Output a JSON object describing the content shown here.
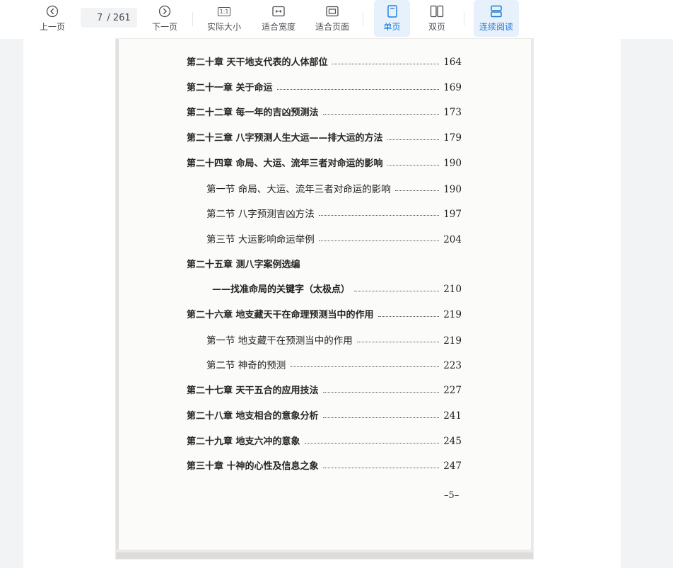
{
  "toolbar": {
    "prev_label": "上一页",
    "next_label": "下一页",
    "current_page": "7",
    "total_pages": "261",
    "actual_size_label": "实际大小",
    "actual_size_glyph": "1:1",
    "fit_width_label": "适合宽度",
    "fit_page_label": "适合页面",
    "single_page_label": "单页",
    "double_page_label": "双页",
    "continuous_label": "连续阅读",
    "accent_color": "#1e7ad6"
  },
  "document": {
    "toc": [
      {
        "type": "chapter",
        "title": "第二十章  天干地支代表的人体部位",
        "page": "164"
      },
      {
        "type": "chapter",
        "title": "第二十一章  关于命运",
        "page": "169"
      },
      {
        "type": "chapter",
        "title": "第二十二章  每一年的吉凶预测法",
        "page": "173"
      },
      {
        "type": "chapter",
        "title": "第二十三章  八字预测人生大运——排大运的方法",
        "page": "179"
      },
      {
        "type": "chapter",
        "title": "第二十四章  命局、大运、流年三者对命运的影响",
        "page": "190"
      },
      {
        "type": "section",
        "title": "第一节  命局、大运、流年三者对命运的影响",
        "page": "190"
      },
      {
        "type": "section",
        "title": "第二节  八字预测吉凶方法",
        "page": "197"
      },
      {
        "type": "section",
        "title": "第三节  大运影响命运举例",
        "page": "204"
      },
      {
        "type": "chapter",
        "title": "第二十五章  测八字案例选编",
        "page": ""
      },
      {
        "type": "sub",
        "title": "——找准命局的关键字（太极点）",
        "page": "210"
      },
      {
        "type": "chapter",
        "title": "第二十六章  地支藏天干在命理预测当中的作用",
        "page": "219"
      },
      {
        "type": "section",
        "title": "第一节  地支藏干在预测当中的作用",
        "page": "219"
      },
      {
        "type": "section",
        "title": "第二节  神奇的预测",
        "page": "223"
      },
      {
        "type": "chapter",
        "title": "第二十七章  天干五合的应用技法",
        "page": "227"
      },
      {
        "type": "chapter",
        "title": "第二十八章  地支相合的意象分析",
        "page": "241"
      },
      {
        "type": "chapter",
        "title": "第二十九章  地支六冲的意象",
        "page": "245"
      },
      {
        "type": "chapter",
        "title": "第三十章  十神的心性及信息之象",
        "page": "247"
      }
    ],
    "folio": "–5–"
  }
}
